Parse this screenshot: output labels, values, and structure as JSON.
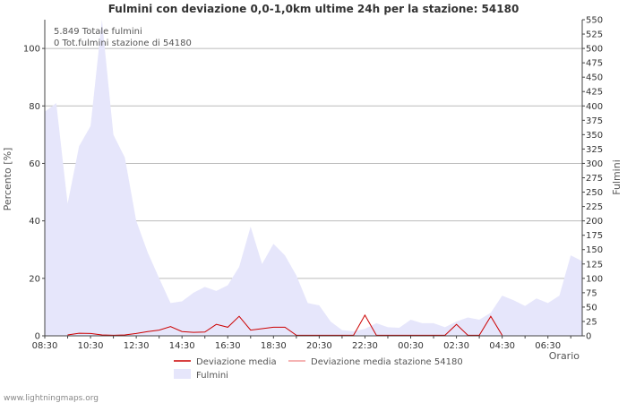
{
  "chart_data": {
    "type": "area",
    "title": "Fulmini con deviazione 0,0-1,0km ultime 24h per la stazione: 54180",
    "xlabel": "Orario",
    "ylabel_left": "Percento   [%]",
    "ylabel_right": "Fulmini",
    "ylim_left": [
      0,
      110
    ],
    "ylim_right": [
      0,
      550
    ],
    "yticks_left": [
      0,
      20,
      40,
      60,
      80,
      100
    ],
    "yticks_right": [
      0,
      25,
      50,
      75,
      100,
      125,
      150,
      175,
      200,
      225,
      250,
      275,
      300,
      325,
      350,
      375,
      400,
      425,
      450,
      475,
      500,
      525,
      550
    ],
    "x_tick_labels": [
      "08:30",
      "10:30",
      "12:30",
      "14:30",
      "16:30",
      "18:30",
      "20:30",
      "22:30",
      "00:30",
      "02:30",
      "04:30",
      "06:30"
    ],
    "x_tick_positions": [
      0,
      2,
      4,
      6,
      8,
      10,
      12,
      14,
      16,
      18,
      20,
      22
    ],
    "x_max": 23.5,
    "grid": true,
    "legend": {
      "position": "bottom",
      "items": [
        "Deviazione media",
        "Deviazione media stazione 54180",
        "Fulmini"
      ]
    },
    "annotations": [
      "5.849 Totale fulmini",
      "0 Tot.fulmini stazione di 54180"
    ],
    "colors": {
      "area_fill": "#e6e6fb",
      "deviazione_media": "#cc0000",
      "deviazione_stazione": "#f29a9a",
      "grid": "#bbbbbb"
    },
    "series": [
      {
        "name": "Fulmini",
        "axis": "right",
        "x": [
          0,
          0.5,
          1,
          1.5,
          2,
          2.5,
          3,
          3.5,
          4,
          4.5,
          5,
          5.5,
          6,
          6.5,
          7,
          7.5,
          8,
          8.5,
          9,
          9.5,
          10,
          10.5,
          11,
          11.5,
          12,
          12.5,
          13,
          13.5,
          14,
          14.5,
          15,
          15.5,
          16,
          16.5,
          17,
          17.5,
          18,
          18.5,
          19,
          19.5,
          20,
          20.5,
          21,
          21.5,
          22,
          22.5,
          23,
          23.5
        ],
        "values": [
          390,
          405,
          230,
          330,
          365,
          570,
          350,
          310,
          200,
          145,
          100,
          57,
          60,
          75,
          85,
          78,
          88,
          120,
          190,
          125,
          160,
          140,
          105,
          57,
          53,
          25,
          10,
          8,
          12,
          22,
          15,
          14,
          28,
          22,
          22,
          15,
          25,
          32,
          28,
          40,
          70,
          62,
          52,
          65,
          57,
          70,
          140,
          130
        ]
      },
      {
        "name": "Deviazione media",
        "axis": "left",
        "x": [
          1,
          1.5,
          2,
          2.5,
          3,
          3.5,
          4,
          4.5,
          5,
          5.5,
          6,
          6.5,
          7,
          7.5,
          8,
          8.5,
          9,
          9.5,
          10,
          10.5,
          11,
          13.5,
          14,
          14.5,
          17.5,
          18,
          18.5,
          19,
          19.5,
          20
        ],
        "values": [
          0.3,
          0.9,
          0.8,
          0.3,
          0.2,
          0.3,
          0.8,
          1.5,
          2.0,
          3.2,
          1.5,
          1.2,
          1.3,
          4.0,
          3.0,
          6.8,
          2.0,
          2.5,
          3.0,
          3.0,
          0.2,
          0.2,
          7.2,
          0.2,
          0.2,
          4.0,
          0.2,
          0.2,
          6.8,
          0.2
        ]
      }
    ]
  },
  "footer": {
    "source": "www.lightningmaps.org"
  }
}
